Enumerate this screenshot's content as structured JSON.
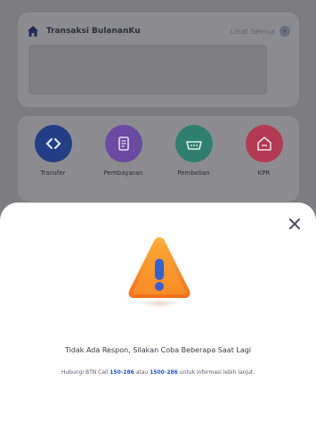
{
  "transactions": {
    "title": "Transaksi BulananKu",
    "see_all": "Lihat Semua"
  },
  "menu": [
    {
      "label": "Transfer",
      "color": "#223e86",
      "icon": "transfer-icon"
    },
    {
      "label": "Pembayaran",
      "color": "#6b4aa1",
      "icon": "receipt-icon"
    },
    {
      "label": "Pembelian",
      "color": "#2e7f6f",
      "icon": "shopping-basket-icon"
    },
    {
      "label": "KPR",
      "color": "#b23a52",
      "icon": "home-loan-icon"
    }
  ],
  "modal": {
    "close_icon": "close-icon",
    "warning_icon": "warning-icon",
    "message": "Tidak Ada Respon, Silakan Coba Beberapa Saat Lagi",
    "help_prefix": "Hubungi BTN Call ",
    "help_number_1": "150-286",
    "help_middle": " atau ",
    "help_number_2": "1500-286",
    "help_suffix": " untuk informasi lebih lanjut."
  }
}
